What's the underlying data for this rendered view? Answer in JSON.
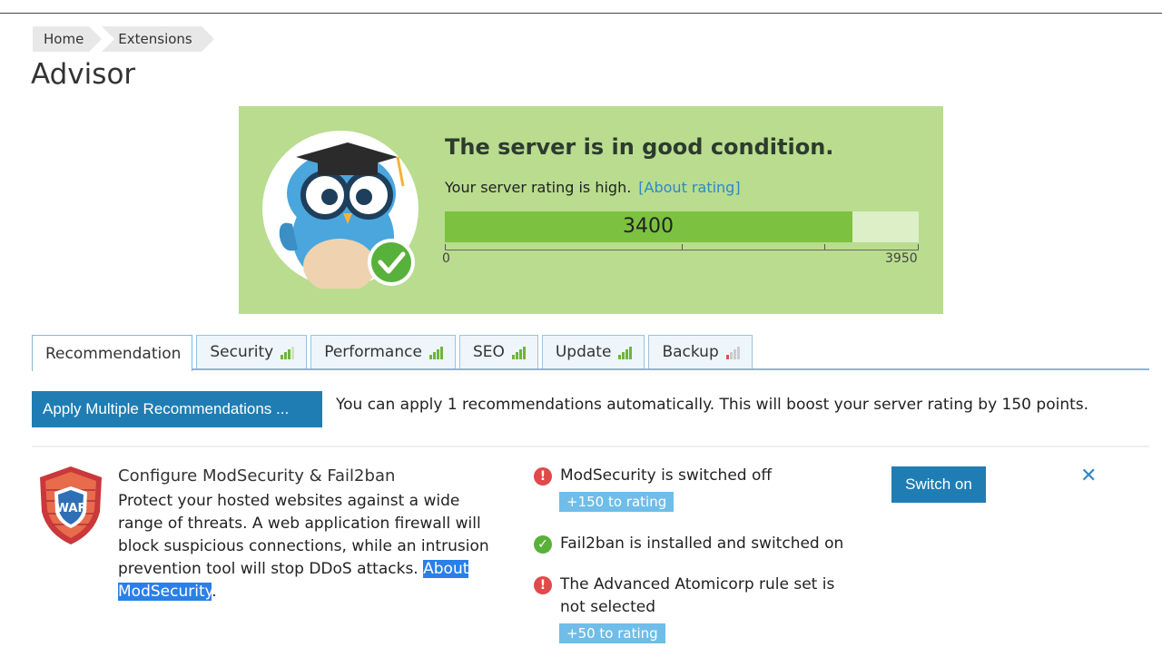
{
  "breadcrumb": {
    "items": [
      "Home",
      "Extensions"
    ]
  },
  "page": {
    "title": "Advisor"
  },
  "status": {
    "headline": "The server is in good condition.",
    "subline": "Your server rating is high.",
    "about_link": "[About rating]",
    "rating": 3400,
    "rating_label": "3400",
    "scale_min": 0,
    "scale_max": 3950,
    "scale_min_label": "0",
    "scale_max_label": "3950",
    "panel_color": "#b9dc8f",
    "fill_color": "#7cc240"
  },
  "tabs": [
    {
      "label": "Recommendation",
      "active": true
    },
    {
      "label": "Security",
      "level": 3
    },
    {
      "label": "Performance",
      "level": 4
    },
    {
      "label": "SEO",
      "level": 4
    },
    {
      "label": "Update",
      "level": 4
    },
    {
      "label": "Backup",
      "level": 1
    }
  ],
  "toolbar": {
    "apply_label": "Apply Multiple Recommendations ...",
    "apply_info": "You can apply 1 recommendations automatically. This will boost your server rating by 150 points."
  },
  "recommendation": {
    "icon": "waf-shield-icon",
    "icon_text": "WAF",
    "title": "Configure ModSecurity & Fail2ban",
    "description": "Protect your hosted websites against a wide range of threats. A web application firewall will block suspicious connections, while an intrusion prevention tool will stop DDoS attacks.",
    "link": "About ModSecurity",
    "link_suffix": ".",
    "checks": [
      {
        "status": "error",
        "text": "ModSecurity is switched off",
        "badge": "+150 to rating"
      },
      {
        "status": "ok",
        "text": "Fail2ban is installed and switched on"
      },
      {
        "status": "error",
        "text": "The Advanced Atomicorp rule set is not selected",
        "badge": "+50 to rating"
      }
    ],
    "action_label": "Switch on",
    "close_glyph": "✕"
  },
  "icons": {
    "error_glyph": "!",
    "ok_glyph": "✓"
  }
}
